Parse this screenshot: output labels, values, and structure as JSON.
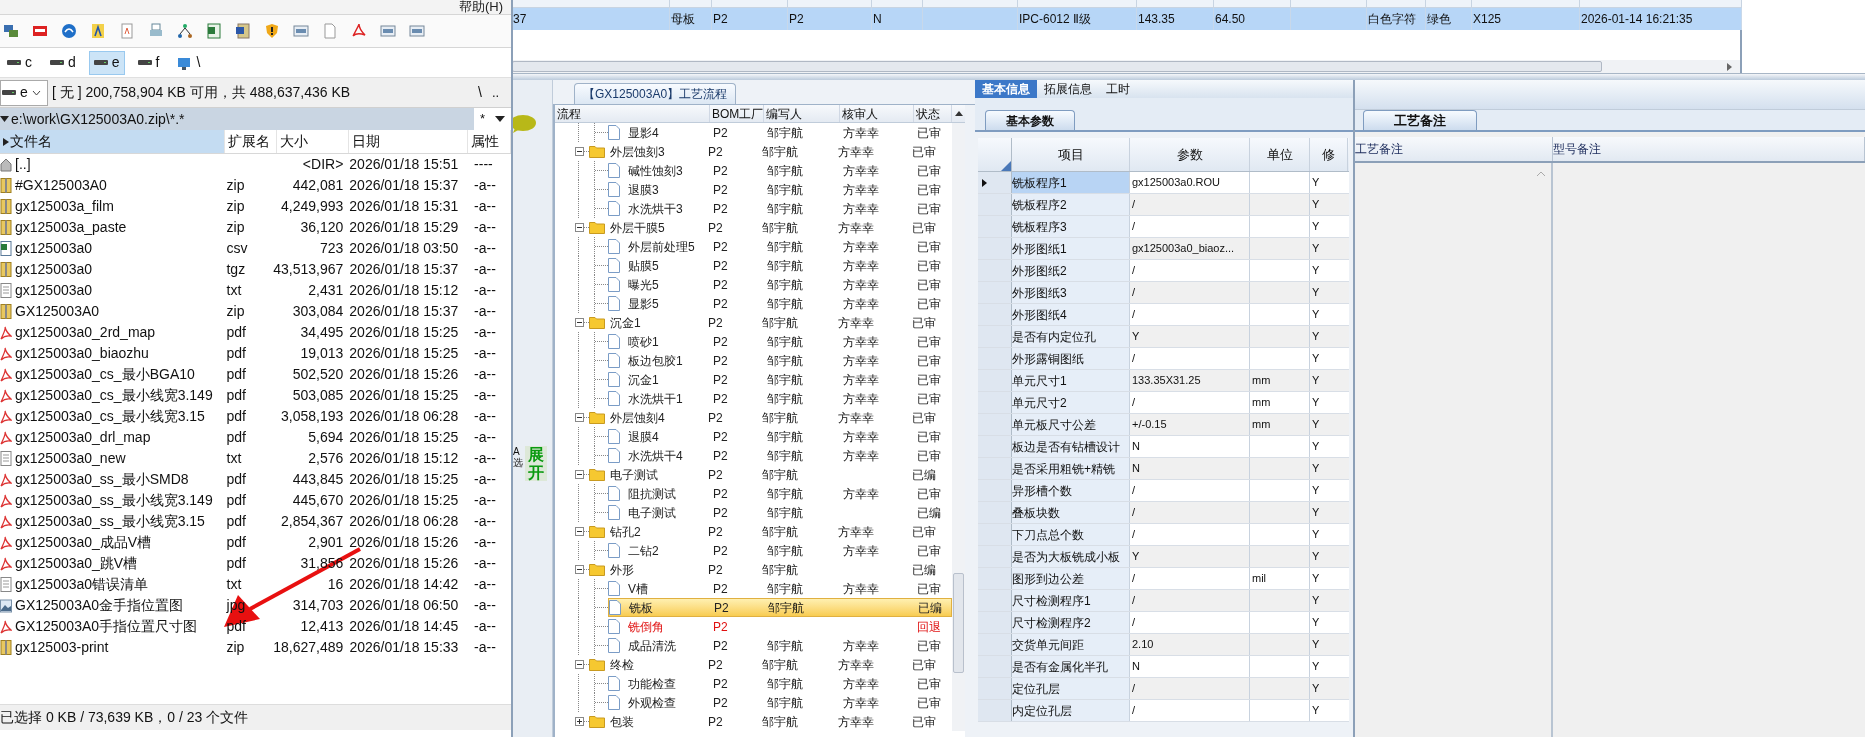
{
  "file_manager": {
    "menu": "帮助(H)",
    "drives": [
      {
        "label": "c",
        "selected": false
      },
      {
        "label": "d",
        "selected": false
      },
      {
        "label": "e",
        "selected": true
      },
      {
        "label": "f",
        "selected": false
      }
    ],
    "network_label": "\\",
    "drive_select": "e",
    "disk_info": "[ 无 ]  200,758,904 KB 可用，共 488,637,436 KB",
    "root_button": "\\",
    "parent_button": "..",
    "path": "e:\\work\\GX125003A0.zip\\*.*",
    "filter": "*",
    "columns": [
      {
        "label": "文件名",
        "selected": true
      },
      {
        "label": "扩展名",
        "selected": false
      },
      {
        "label": "大小",
        "selected": false
      },
      {
        "label": "日期",
        "selected": false
      },
      {
        "label": "属性",
        "selected": false
      }
    ],
    "files": [
      {
        "kind": "up",
        "name": "[..]",
        "size": "<DIR>",
        "date": "2026/01/18 15:51",
        "attr": "----"
      },
      {
        "kind": "archive",
        "name": "#GX125003A0",
        "ext": "zip",
        "size": "442,081",
        "date": "2026/01/18 15:37",
        "attr": "-a--"
      },
      {
        "kind": "archive",
        "name": "gx125003a_film",
        "ext": "zip",
        "size": "4,249,993",
        "date": "2026/01/18 15:31",
        "attr": "-a--"
      },
      {
        "kind": "archive",
        "name": "gx125003a_paste",
        "ext": "zip",
        "size": "36,120",
        "date": "2026/01/18 15:29",
        "attr": "-a--"
      },
      {
        "kind": "spreadsheet",
        "name": "gx125003a0",
        "ext": "csv",
        "size": "723",
        "date": "2026/01/18 03:50",
        "attr": "-a--"
      },
      {
        "kind": "archive",
        "name": "gx125003a0",
        "ext": "tgz",
        "size": "43,513,967",
        "date": "2026/01/18 15:37",
        "attr": "-a--"
      },
      {
        "kind": "text",
        "name": "gx125003a0",
        "ext": "txt",
        "size": "2,431",
        "date": "2026/01/18 15:12",
        "attr": "-a--"
      },
      {
        "kind": "archive",
        "name": "GX125003A0",
        "ext": "zip",
        "size": "303,084",
        "date": "2026/01/18 15:37",
        "attr": "-a--"
      },
      {
        "kind": "pdf",
        "name": "gx125003a0_2rd_map",
        "ext": "pdf",
        "size": "34,495",
        "date": "2026/01/18 15:25",
        "attr": "-a--"
      },
      {
        "kind": "pdf",
        "name": "gx125003a0_biaozhu",
        "ext": "pdf",
        "size": "19,013",
        "date": "2026/01/18 15:25",
        "attr": "-a--"
      },
      {
        "kind": "pdf",
        "name": "gx125003a0_cs_最小BGA10",
        "ext": "pdf",
        "size": "502,520",
        "date": "2026/01/18 15:26",
        "attr": "-a--"
      },
      {
        "kind": "pdf",
        "name": "gx125003a0_cs_最小线宽3.149",
        "ext": "pdf",
        "size": "503,085",
        "date": "2026/01/18 15:25",
        "attr": "-a--"
      },
      {
        "kind": "pdf",
        "name": "gx125003a0_cs_最小线宽3.15",
        "ext": "pdf",
        "size": "3,058,193",
        "date": "2026/01/18 06:28",
        "attr": "-a--"
      },
      {
        "kind": "pdf",
        "name": "gx125003a0_drl_map",
        "ext": "pdf",
        "size": "5,694",
        "date": "2026/01/18 15:25",
        "attr": "-a--"
      },
      {
        "kind": "text",
        "name": "gx125003a0_new",
        "ext": "txt",
        "size": "2,576",
        "date": "2026/01/18 15:12",
        "attr": "-a--"
      },
      {
        "kind": "pdf",
        "name": "gx125003a0_ss_最小SMD8",
        "ext": "pdf",
        "size": "443,845",
        "date": "2026/01/18 15:25",
        "attr": "-a--"
      },
      {
        "kind": "pdf",
        "name": "gx125003a0_ss_最小线宽3.149",
        "ext": "pdf",
        "size": "445,670",
        "date": "2026/01/18 15:25",
        "attr": "-a--"
      },
      {
        "kind": "pdf",
        "name": "gx125003a0_ss_最小线宽3.15",
        "ext": "pdf",
        "size": "2,854,367",
        "date": "2026/01/18 06:28",
        "attr": "-a--"
      },
      {
        "kind": "pdf",
        "name": "gx125003a0_成品V槽",
        "ext": "pdf",
        "size": "2,901",
        "date": "2026/01/18 15:26",
        "attr": "-a--"
      },
      {
        "kind": "pdf",
        "name": "gx125003a0_跳V槽",
        "ext": "pdf",
        "size": "31,856",
        "date": "2026/01/18 15:26",
        "attr": "-a--"
      },
      {
        "kind": "text",
        "name": "gx125003a0错误清单",
        "ext": "txt",
        "size": "16",
        "date": "2026/01/18 14:42",
        "attr": "-a--"
      },
      {
        "kind": "image",
        "name": "GX125003A0金手指位置图",
        "ext": "jpg",
        "size": "314,703",
        "date": "2026/01/18 06:50",
        "attr": "-a--"
      },
      {
        "kind": "pdf",
        "name": "GX125003A0手指位置尺寸图",
        "ext": "pdf",
        "size": "12,413",
        "date": "2026/01/18 14:45",
        "attr": "-a--"
      },
      {
        "kind": "archive",
        "name": "gx125003-print",
        "ext": "zip",
        "size": "18,627,489",
        "date": "2026/01/18 15:33",
        "attr": "-a--"
      }
    ],
    "status_bar": "已选择 0 KB / 73,639 KB，0 / 23 个文件"
  },
  "top_table": {
    "row": {
      "column_1": "37",
      "column_2": "母板",
      "column_3": "P2",
      "column_4": "P2",
      "column_5": "N",
      "column_7": "IPC-6012 Ⅱ级",
      "column_8": "143.35",
      "column_9": "64.50",
      "column_11": "白色字符",
      "column_12": "绿色",
      "column_13": "X125",
      "column_14": "2026-01-14 16:21:35"
    }
  },
  "side_strip": {
    "side_label": "A选",
    "expand_button": "展开"
  },
  "process_flow": {
    "title": "【GX125003A0】工艺流程",
    "columns": [
      "流程",
      "BOM工厂",
      "编写人",
      "核审人",
      "状态"
    ],
    "rows": [
      {
        "kind": "step",
        "name": "显影4",
        "bom": "P2",
        "author": "邹宇航",
        "reviewer": "方幸幸",
        "status": "已审",
        "returned": false,
        "selected": false
      },
      {
        "kind": "group",
        "name": "外层蚀刻3",
        "bom": "P2",
        "author": "邹宇航",
        "reviewer": "方幸幸",
        "status": "已审",
        "returned": false,
        "selected": false,
        "expanded": true,
        "children": [
          {
            "kind": "step",
            "name": "碱性蚀刻3",
            "bom": "P2",
            "author": "邹宇航",
            "reviewer": "方幸幸",
            "status": "已审",
            "returned": false,
            "selected": false
          },
          {
            "kind": "step",
            "name": "退膜3",
            "bom": "P2",
            "author": "邹宇航",
            "reviewer": "方幸幸",
            "status": "已审",
            "returned": false,
            "selected": false
          },
          {
            "kind": "step",
            "name": "水洗烘干3",
            "bom": "P2",
            "author": "邹宇航",
            "reviewer": "方幸幸",
            "status": "已审",
            "returned": false,
            "selected": false
          }
        ]
      },
      {
        "kind": "group",
        "name": "外层干膜5",
        "bom": "P2",
        "author": "邹宇航",
        "reviewer": "方幸幸",
        "status": "已审",
        "returned": false,
        "selected": false,
        "expanded": true,
        "children": [
          {
            "kind": "step",
            "name": "外层前处理5",
            "bom": "P2",
            "author": "邹宇航",
            "reviewer": "方幸幸",
            "status": "已审",
            "returned": false,
            "selected": false
          },
          {
            "kind": "step",
            "name": "贴膜5",
            "bom": "P2",
            "author": "邹宇航",
            "reviewer": "方幸幸",
            "status": "已审",
            "returned": false,
            "selected": false
          },
          {
            "kind": "step",
            "name": "曝光5",
            "bom": "P2",
            "author": "邹宇航",
            "reviewer": "方幸幸",
            "status": "已审",
            "returned": false,
            "selected": false
          },
          {
            "kind": "step",
            "name": "显影5",
            "bom": "P2",
            "author": "邹宇航",
            "reviewer": "方幸幸",
            "status": "已审",
            "returned": false,
            "selected": false
          }
        ]
      },
      {
        "kind": "group",
        "name": "沉金1",
        "bom": "P2",
        "author": "邹宇航",
        "reviewer": "方幸幸",
        "status": "已审",
        "returned": false,
        "selected": false,
        "expanded": true,
        "children": [
          {
            "kind": "step",
            "name": "喷砂1",
            "bom": "P2",
            "author": "邹宇航",
            "reviewer": "方幸幸",
            "status": "已审",
            "returned": false,
            "selected": false
          },
          {
            "kind": "step",
            "name": "板边包胶1",
            "bom": "P2",
            "author": "邹宇航",
            "reviewer": "方幸幸",
            "status": "已审",
            "returned": false,
            "selected": false
          },
          {
            "kind": "step",
            "name": "沉金1",
            "bom": "P2",
            "author": "邹宇航",
            "reviewer": "方幸幸",
            "status": "已审",
            "returned": false,
            "selected": false
          },
          {
            "kind": "step",
            "name": "水洗烘干1",
            "bom": "P2",
            "author": "邹宇航",
            "reviewer": "方幸幸",
            "status": "已审",
            "returned": false,
            "selected": false
          }
        ]
      },
      {
        "kind": "group",
        "name": "外层蚀刻4",
        "bom": "P2",
        "author": "邹宇航",
        "reviewer": "方幸幸",
        "status": "已审",
        "returned": false,
        "selected": false,
        "expanded": true,
        "children": [
          {
            "kind": "step",
            "name": "退膜4",
            "bom": "P2",
            "author": "邹宇航",
            "reviewer": "方幸幸",
            "status": "已审",
            "returned": false,
            "selected": false
          },
          {
            "kind": "step",
            "name": "水洗烘干4",
            "bom": "P2",
            "author": "邹宇航",
            "reviewer": "方幸幸",
            "status": "已审",
            "returned": false,
            "selected": false
          }
        ]
      },
      {
        "kind": "group",
        "name": "电子测试",
        "bom": "P2",
        "author": "邹宇航",
        "status": "已编",
        "returned": false,
        "selected": false,
        "expanded": true,
        "children": [
          {
            "kind": "step",
            "name": "阻抗测试",
            "bom": "P2",
            "author": "邹宇航",
            "reviewer": "方幸幸",
            "status": "已审",
            "returned": false,
            "selected": false
          },
          {
            "kind": "step",
            "name": "电子测试",
            "bom": "P2",
            "author": "邹宇航",
            "status": "已编",
            "returned": false,
            "selected": false
          }
        ]
      },
      {
        "kind": "group",
        "name": "钻孔2",
        "bom": "P2",
        "author": "邹宇航",
        "reviewer": "方幸幸",
        "status": "已审",
        "returned": false,
        "selected": false,
        "expanded": true,
        "children": [
          {
            "kind": "step",
            "name": "二钻2",
            "bom": "P2",
            "author": "邹宇航",
            "reviewer": "方幸幸",
            "status": "已审",
            "returned": false,
            "selected": false
          }
        ]
      },
      {
        "kind": "group",
        "name": "外形",
        "bom": "P2",
        "author": "邹宇航",
        "status": "已编",
        "returned": false,
        "selected": false,
        "expanded": true,
        "children": [
          {
            "kind": "step",
            "name": "V槽",
            "bom": "P2",
            "author": "邹宇航",
            "reviewer": "方幸幸",
            "status": "已审",
            "returned": false,
            "selected": false
          },
          {
            "kind": "step",
            "name": "铣板",
            "bom": "P2",
            "author": "邹宇航",
            "status": "已编",
            "returned": false,
            "selected": true
          },
          {
            "kind": "step",
            "name": "铣倒角",
            "bom": "P2",
            "status": "回退",
            "returned": true,
            "selected": false
          },
          {
            "kind": "step",
            "name": "成品清洗",
            "bom": "P2",
            "author": "邹宇航",
            "reviewer": "方幸幸",
            "status": "已审",
            "returned": false,
            "selected": false
          }
        ]
      },
      {
        "kind": "group",
        "name": "终检",
        "bom": "P2",
        "author": "邹宇航",
        "reviewer": "方幸幸",
        "status": "已审",
        "returned": false,
        "selected": false,
        "expanded": true,
        "children": [
          {
            "kind": "step",
            "name": "功能检查",
            "bom": "P2",
            "author": "邹宇航",
            "reviewer": "方幸幸",
            "status": "已审",
            "returned": false,
            "selected": false
          },
          {
            "kind": "step",
            "name": "外观检查",
            "bom": "P2",
            "author": "邹宇航",
            "reviewer": "方幸幸",
            "status": "已审",
            "returned": false,
            "selected": false
          }
        ]
      },
      {
        "kind": "group",
        "name": "包装",
        "bom": "P2",
        "author": "邹宇航",
        "reviewer": "方幸幸",
        "status": "已审",
        "returned": false,
        "selected": false,
        "expanded": false
      }
    ]
  },
  "params_panel": {
    "tabs": [
      {
        "label": "基本信息",
        "selected": true
      },
      {
        "label": "拓展信息",
        "selected": false
      },
      {
        "label": "工时",
        "selected": false
      }
    ],
    "sub_tab": "基本参数",
    "columns": [
      "项目",
      "参数",
      "单位",
      "修"
    ],
    "rows": [
      {
        "item": "铣板程序1",
        "value": "gx125003a0.ROU",
        "modified": "Y",
        "selected": true
      },
      {
        "item": "铣板程序2",
        "value": "/",
        "modified": "Y",
        "selected": false
      },
      {
        "item": "铣板程序3",
        "value": "/",
        "modified": "Y",
        "selected": false
      },
      {
        "item": "外形图纸1",
        "value": "gx125003a0_biaoz...",
        "modified": "Y",
        "selected": false
      },
      {
        "item": "外形图纸2",
        "value": "/",
        "modified": "Y",
        "selected": false
      },
      {
        "item": "外形图纸3",
        "value": "/",
        "modified": "Y",
        "selected": false
      },
      {
        "item": "外形图纸4",
        "value": "/",
        "modified": "Y",
        "selected": false
      },
      {
        "item": "是否有内定位孔",
        "value": "Y",
        "modified": "Y",
        "selected": false
      },
      {
        "item": "外形露铜图纸",
        "value": "/",
        "modified": "Y",
        "selected": false
      },
      {
        "item": "单元尺寸1",
        "value": "133.35X31.25",
        "unit": "mm",
        "modified": "Y",
        "selected": false
      },
      {
        "item": "单元尺寸2",
        "value": "/",
        "unit": "mm",
        "modified": "Y",
        "selected": false
      },
      {
        "item": "单元板尺寸公差",
        "value": "+/-0.15",
        "unit": "mm",
        "modified": "Y",
        "selected": false
      },
      {
        "item": "板边是否有钻槽设计",
        "value": "N",
        "modified": "Y",
        "selected": false
      },
      {
        "item": "是否采用粗铣+精铣",
        "value": "N",
        "modified": "Y",
        "selected": false
      },
      {
        "item": "异形槽个数",
        "value": "/",
        "modified": "Y",
        "selected": false
      },
      {
        "item": "叠板块数",
        "value": "/",
        "modified": "Y",
        "selected": false
      },
      {
        "item": "下刀点总个数",
        "value": "/",
        "modified": "Y",
        "selected": false
      },
      {
        "item": "是否为大板铣成小板",
        "value": "Y",
        "modified": "Y",
        "selected": false
      },
      {
        "item": "图形到边公差",
        "value": "/",
        "unit": "mil",
        "modified": "Y",
        "selected": false
      },
      {
        "item": "尺寸检测程序1",
        "value": "/",
        "modified": "Y",
        "selected": false
      },
      {
        "item": "尺寸检测程序2",
        "value": "/",
        "modified": "Y",
        "selected": false
      },
      {
        "item": "交货单元间距",
        "value": "2.10",
        "modified": "Y",
        "selected": false
      },
      {
        "item": "是否有金属化半孔",
        "value": "N",
        "modified": "Y",
        "selected": false
      },
      {
        "item": "定位孔层",
        "value": "/",
        "modified": "Y",
        "selected": false
      },
      {
        "item": "内定位孔层",
        "value": "/",
        "modified": "Y",
        "selected": false
      }
    ]
  },
  "remarks_panel": {
    "tab": "工艺备注",
    "columns": [
      "工艺备注",
      "型号备注"
    ]
  }
}
